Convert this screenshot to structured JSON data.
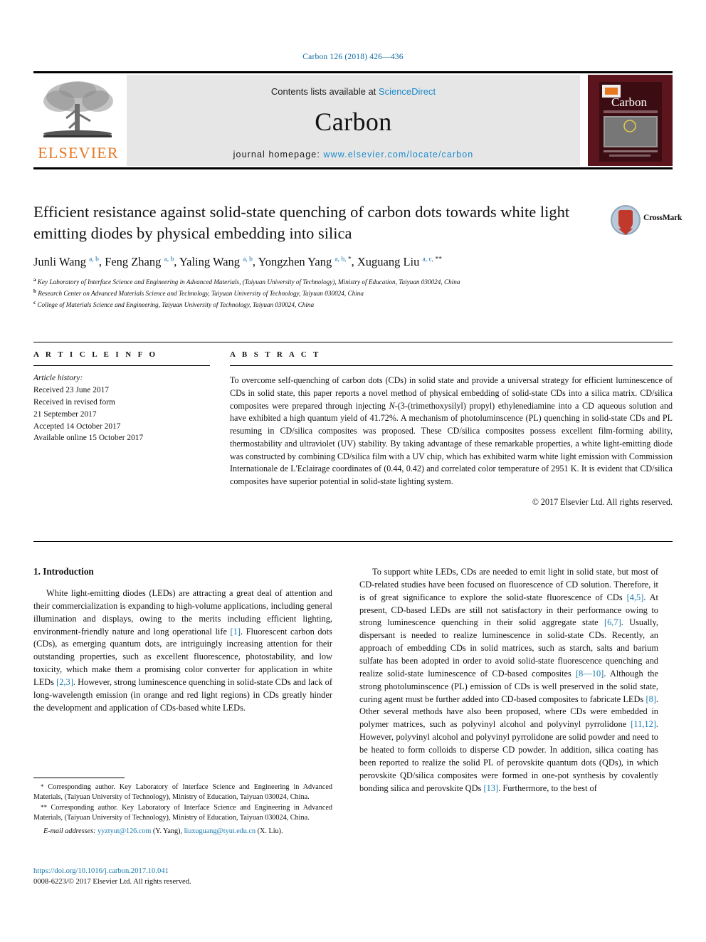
{
  "running_head": "Carbon 126 (2018) 426—436",
  "masthead": {
    "contents_prefix": "Contents lists available at ",
    "contents_link": "ScienceDirect",
    "journal_name": "Carbon",
    "homepage_prefix": "journal homepage: ",
    "homepage_url": "www.elsevier.com/locate/carbon",
    "publisher_logo_text": "ELSEVIER",
    "cover_journal_title": "Carbon"
  },
  "crossmark": {
    "label": "CrossMark"
  },
  "article": {
    "title": "Efficient resistance against solid-state quenching of carbon dots towards white light emitting diodes by physical embedding into silica",
    "authors_html": "Junli Wang <sup>a, b</sup>, Feng Zhang <sup>a, b</sup>, Yaling Wang <sup>a, b</sup>, Yongzhen Yang <sup>a, b, </sup><sup class=\"star\">*</sup>, Xuguang Liu <sup>a, c, </sup><sup class=\"star\">**</sup>",
    "affiliations": [
      {
        "mark": "a",
        "text": "Key Laboratory of Interface Science and Engineering in Advanced Materials, (Taiyuan University of Technology), Ministry of Education, Taiyuan 030024, China"
      },
      {
        "mark": "b",
        "text": "Research Center on Advanced Materials Science and Technology, Taiyuan University of Technology, Taiyuan 030024, China"
      },
      {
        "mark": "c",
        "text": "College of Materials Science and Engineering, Taiyuan University of Technology, Taiyuan 030024, China"
      }
    ]
  },
  "article_info": {
    "heading": "A R T I C L E  I N F O",
    "history_label": "Article history:",
    "history_lines": [
      "Received 23 June 2017",
      "Received in revised form",
      "21 September 2017",
      "Accepted 14 October 2017",
      "Available online 15 October 2017"
    ]
  },
  "abstract": {
    "heading": "A B S T R A C T",
    "text_html": "To overcome self-quenching of carbon dots (CDs) in solid state and provide a universal strategy for efficient luminescence of CDs in solid state, this paper reports a novel method of physical embedding of solid-state CDs into a silica matrix. CD/silica composites were prepared through injecting <span class=\"it\">N</span>-(3-(trimethoxysilyl) propyl) ethylenediamine into a CD aqueous solution and have exhibited a high quantum yield of 41.72%. A mechanism of photoluminscence (PL) quenching in solid-state CDs and PL resuming in CD/silica composites was proposed. These CD/silica composites possess excellent film-forming ability, thermostability and ultraviolet (UV) stability. By taking advantage of these remarkable properties, a white light-emitting diode was constructed by combining CD/silica film with a UV chip, which has exhibited warm white light emission with Commission Internationale de L'Eclairage coordinates of (0.44, 0.42) and correlated color temperature of 2951 K. It is evident that CD/silica composites have superior potential in solid-state lighting system.",
    "copyright": "© 2017 Elsevier Ltd. All rights reserved."
  },
  "body": {
    "section_title": "1. Introduction",
    "left_paragraph_html": "White light-emitting diodes (LEDs) are attracting a great deal of attention and their commercialization is expanding to high-volume applications, including general illumination and displays, owing to the merits including efficient lighting, environment-friendly nature and long operational life <span class=\"ref\">[1]</span>. Fluorescent carbon dots (CDs), as emerging quantum dots, are intriguingly increasing attention for their outstanding properties, such as excellent fluorescence, photostability, and low toxicity, which make them a promising color converter for application in white LEDs <span class=\"ref\">[2,3]</span>. However, strong luminescence quenching in solid-state CDs and lack of long-wavelength emission (in orange and red light regions) in CDs greatly hinder the development and application of CDs-based white LEDs.",
    "right_paragraph_html": "To support white LEDs, CDs are needed to emit light in solid state, but most of CD-related studies have been focused on fluorescence of CD solution. Therefore, it is of great significance to explore the solid-state fluorescence of CDs <span class=\"ref\">[4,5]</span>. At present, CD-based LEDs are still not satisfactory in their performance owing to strong luminescence quenching in their solid aggregate state <span class=\"ref\">[6,7]</span>. Usually, dispersant is needed to realize luminescence in solid-state CDs. Recently, an approach of embedding CDs in solid matrices, such as starch, salts and barium sulfate has been adopted in order to avoid solid-state fluorescence quenching and realize solid-state luminescence of CD-based composites <span class=\"ref\">[8—10]</span>. Although the strong photoluminscence (PL) emission of CDs is well preserved in the solid state, curing agent must be further added into CD-based composites to fabricate LEDs <span class=\"ref\">[8]</span>. Other several methods have also been proposed, where CDs were embedded in polymer matrices, such as polyvinyl alcohol and polyvinyl pyrrolidone <span class=\"ref\">[11,12]</span>. However, polyvinyl alcohol and polyvinyl pyrrolidone are solid powder and need to be heated to form colloids to disperse CD powder. In addition, silica coating has been reported to realize the solid PL of perovskite quantum dots (QDs), in which perovskite QD/silica composites were formed in one-pot synthesis by covalently bonding silica and perovskite QDs <span class=\"ref\">[13]</span>. Furthermore, to the best of"
  },
  "footnotes": {
    "note1_html": "<span class=\"mark\">*</span> Corresponding author. Key Laboratory of Interface Science and Engineering in Advanced Materials, (Taiyuan University of Technology), Ministry of Education, Taiyuan 030024, China.",
    "note2_html": "<span class=\"mark\">**</span> Corresponding author. Key Laboratory of Interface Science and Engineering in Advanced Materials, (Taiyuan University of Technology), Ministry of Education, Taiyuan 030024, China.",
    "email_html": "<span class=\"lbl\">E-mail addresses:</span> <span class=\"mail\">yyztyut@126.com</span> (Y. Yang), <span class=\"mail\">liuxuguang@tyut.edu.cn</span> (X. Liu)."
  },
  "imprint": {
    "doi": "https://doi.org/10.1016/j.carbon.2017.10.041",
    "issn_line": "0008-6223/© 2017 Elsevier Ltd. All rights reserved."
  },
  "colors": {
    "link": "#1a7aad",
    "running_head": "#0b6aa2",
    "elsevier_orange": "#e87722",
    "panel_grey": "#e6e6e6",
    "cover_maroon": "#6d1a22"
  }
}
